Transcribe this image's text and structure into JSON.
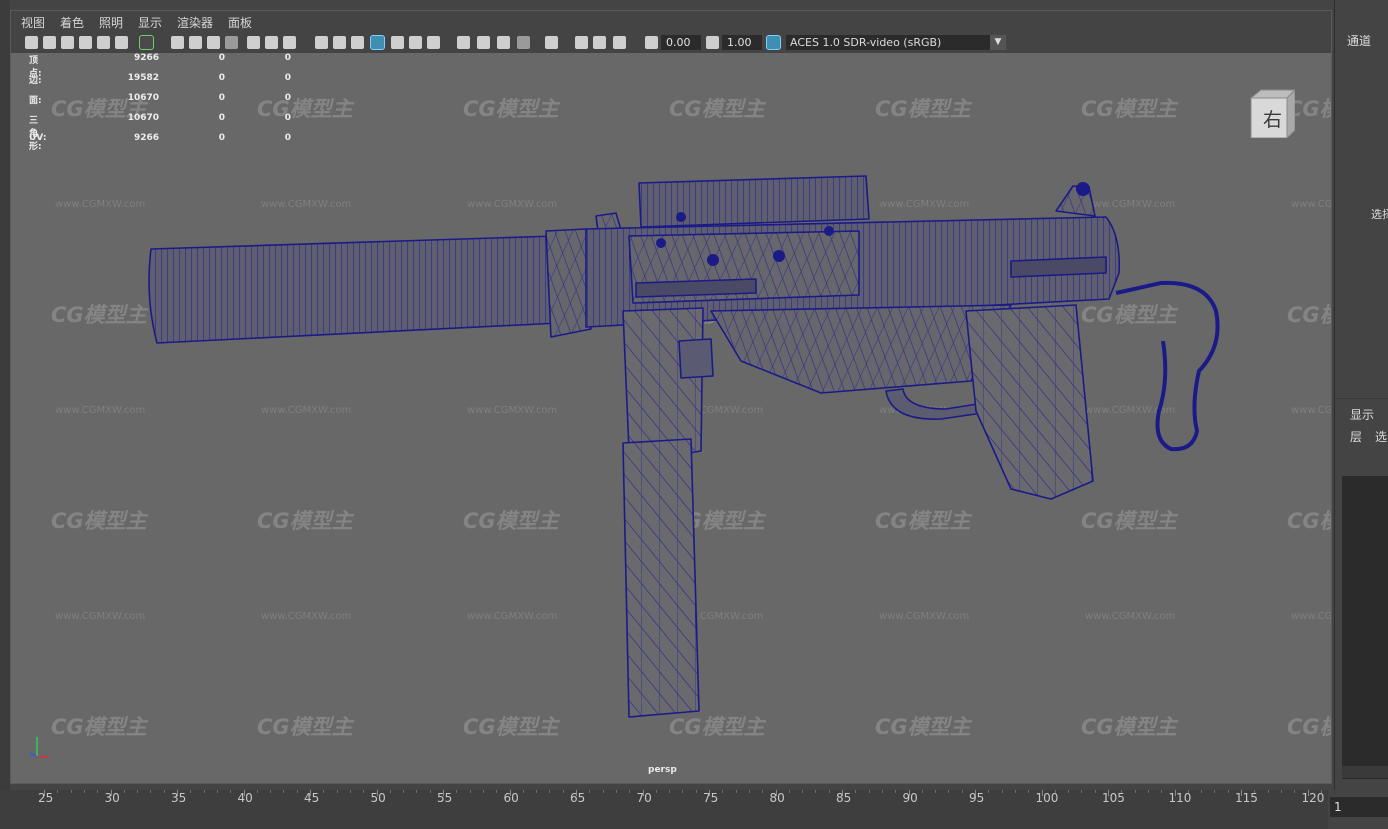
{
  "menu": [
    "视图",
    "着色",
    "照明",
    "显示",
    "渲染器",
    "面板"
  ],
  "toolbar": {
    "exposure": "0.00",
    "gamma": "1.00",
    "color_transform": "ACES 1.0 SDR-video (sRGB)"
  },
  "stats": [
    {
      "label": "顶点:",
      "v1": "9266",
      "v2": "0",
      "v3": "0"
    },
    {
      "label": "边:",
      "v1": "19582",
      "v2": "0",
      "v3": "0"
    },
    {
      "label": "面:",
      "v1": "10670",
      "v2": "0",
      "v3": "0"
    },
    {
      "label": "三角形:",
      "v1": "10670",
      "v2": "0",
      "v3": "0"
    },
    {
      "label": "UV:",
      "v1": "9266",
      "v2": "0",
      "v3": "0"
    }
  ],
  "viewport": {
    "camera": "persp",
    "viewcube_label": "右",
    "watermark_logo": "CG模型主",
    "watermark_url": "www.CGMXW.com",
    "wire_color": "#1d1d8a",
    "bg_color": "#686868"
  },
  "right_panel": {
    "channel_tab": "通道",
    "select_label": "选择",
    "display_tab": "显示",
    "layer_tab": "层",
    "select_tab": "选"
  },
  "timeline": {
    "ticks": [
      "25",
      "30",
      "35",
      "40",
      "45",
      "50",
      "55",
      "60",
      "65",
      "70",
      "75",
      "80",
      "85",
      "90",
      "95",
      "100",
      "105",
      "110",
      "115",
      "120"
    ],
    "current_frame": "1"
  }
}
